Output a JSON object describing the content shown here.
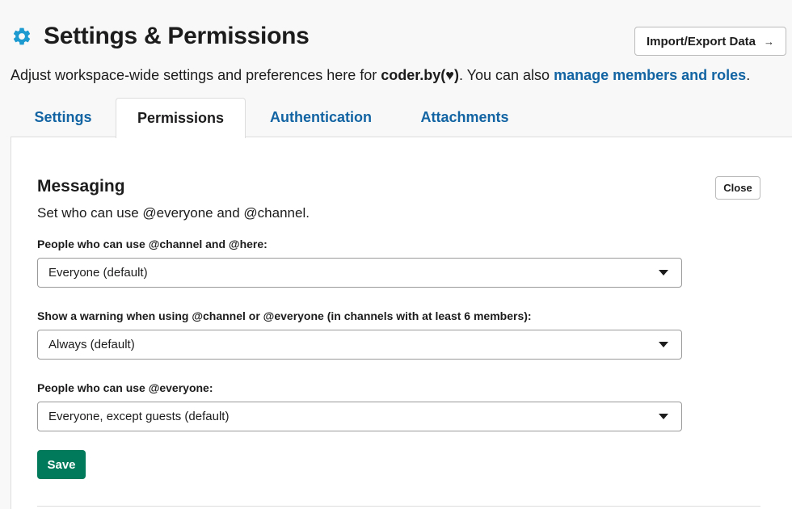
{
  "header": {
    "title": "Settings & Permissions",
    "import_export_label": "Import/Export Data",
    "arrow": "→"
  },
  "subtitle": {
    "prefix": "Adjust workspace-wide settings and preferences here for ",
    "workspace": "coder.by(♥)",
    "middle": ". You can also ",
    "link": "manage members and roles",
    "suffix": "."
  },
  "tabs": [
    {
      "label": "Settings"
    },
    {
      "label": "Permissions",
      "active": true
    },
    {
      "label": "Authentication"
    },
    {
      "label": "Attachments"
    }
  ],
  "section": {
    "title": "Messaging",
    "description": "Set who can use @everyone and @channel.",
    "close_label": "Close",
    "save_label": "Save",
    "fields": [
      {
        "label": "People who can use @channel and @here:",
        "value": "Everyone (default)"
      },
      {
        "label": "Show a warning when using @channel or @everyone (in channels with at least 6 members):",
        "value": "Always (default)"
      },
      {
        "label": "People who can use @everyone:",
        "value": "Everyone, except guests (default)"
      }
    ]
  },
  "colors": {
    "accent_link": "#1264a3",
    "save_button": "#007a5a",
    "gear_icon": "#1d9bd1"
  }
}
